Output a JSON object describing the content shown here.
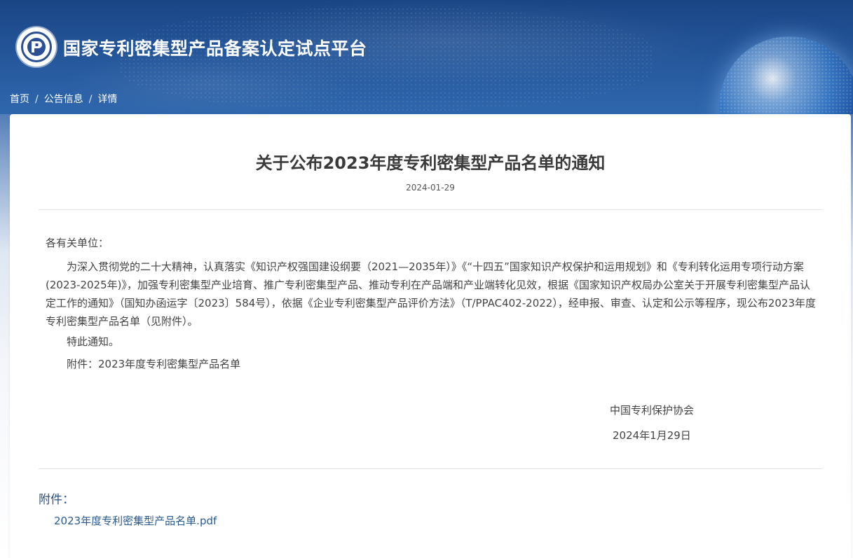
{
  "header": {
    "site_title": "国家专利密集型产品备案认定试点平台",
    "breadcrumb": [
      "首页",
      "公告信息",
      "详情"
    ],
    "breadcrumb_separator": "/"
  },
  "article": {
    "title": "关于公布2023年度专利密集型产品名单的通知",
    "date": "2024-01-29",
    "salutation": "各有关单位：",
    "paragraph": "为深入贯彻党的二十大精神，认真落实《知识产权强国建设纲要（2021—2035年）》《“十四五”国家知识产权保护和运用规划》和《专利转化运用专项行动方案(2023-2025年)》，加强专利密集型产业培育、推广专利密集型产品、推动专利在产品端和产业端转化见效，根据《国家知识产权局办公室关于开展专利密集型产品认定工作的通知》（国知办函运字〔2023〕584号），依据《企业专利密集型产品评价方法》（T/PPAC402-2022），经申报、审查、认定和公示等程序，现公布2023年度专利密集型产品名单（见附件）。",
    "closing": "特此通知。",
    "attachment_note": "附件：2023年度专利密集型产品名单",
    "signature_org": "中国专利保护协会",
    "signature_date": "2024年1月29日"
  },
  "attachments": {
    "label": "附件：",
    "files": [
      "2023年度专利密集型产品名单.pdf"
    ]
  },
  "colors": {
    "header_blue": "#1c4a8c",
    "link_blue": "#2a5a90",
    "title_text": "#3a3a3a",
    "body_text": "#444444"
  },
  "icons": {
    "logo": "patent-association-logo-icon",
    "globe": "globe-decoration-icon"
  }
}
